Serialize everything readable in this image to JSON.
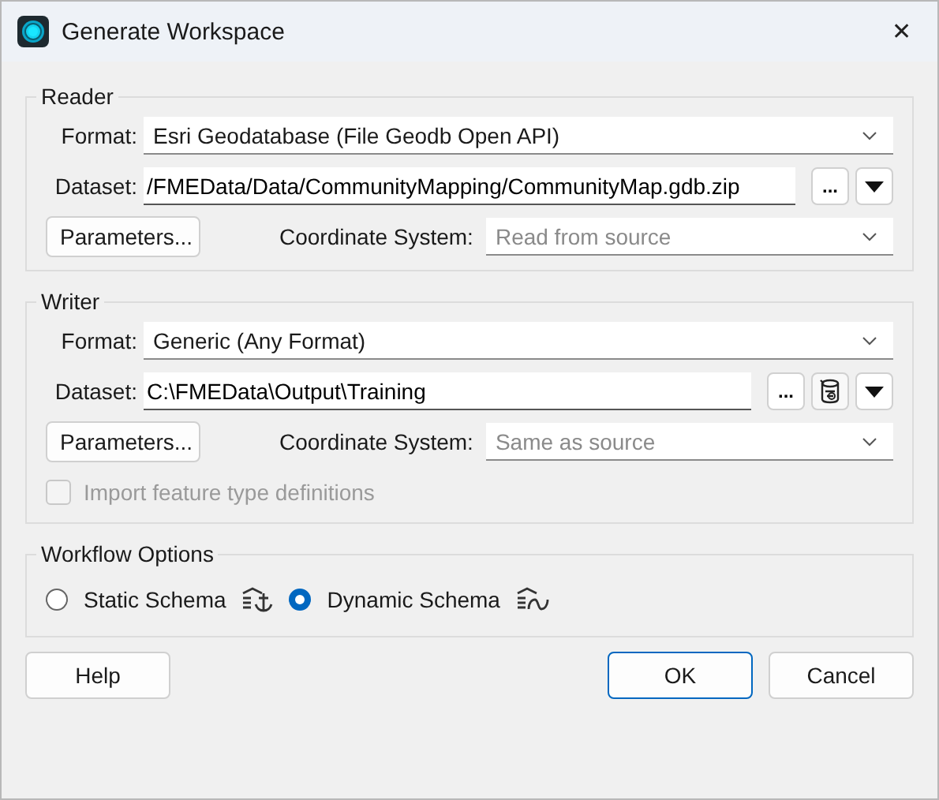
{
  "window": {
    "title": "Generate Workspace",
    "close": "✕"
  },
  "reader": {
    "title": "Reader",
    "format": {
      "label": "Format:",
      "value": "Esri Geodatabase (File Geodb Open API)"
    },
    "dataset": {
      "label": "Dataset:",
      "value": "/FMEData/Data/CommunityMapping/CommunityMap.gdb.zip",
      "browse": "..."
    },
    "parameters": "Parameters...",
    "coordinate_system": {
      "label": "Coordinate System:",
      "placeholder": "Read from source"
    }
  },
  "writer": {
    "title": "Writer",
    "format": {
      "label": "Format:",
      "value": "Generic (Any Format)"
    },
    "dataset": {
      "label": "Dataset:",
      "value": "C:\\FMEData\\Output\\Training",
      "browse": "...",
      "database_button": true
    },
    "parameters": "Parameters...",
    "coordinate_system": {
      "label": "Coordinate System:",
      "placeholder": "Same as source"
    },
    "import_checkbox": {
      "label": "Import feature type definitions",
      "checked": false,
      "disabled": true
    }
  },
  "workflow": {
    "title": "Workflow Options",
    "options": [
      {
        "kind": "static",
        "label": "Static Schema",
        "selected": false
      },
      {
        "kind": "dynamic",
        "label": "Dynamic Schema",
        "selected": true
      }
    ]
  },
  "buttons": [
    {
      "label": "Help",
      "default": false
    },
    {
      "label": "OK",
      "default": true
    },
    {
      "label": "Cancel",
      "default": false
    }
  ]
}
